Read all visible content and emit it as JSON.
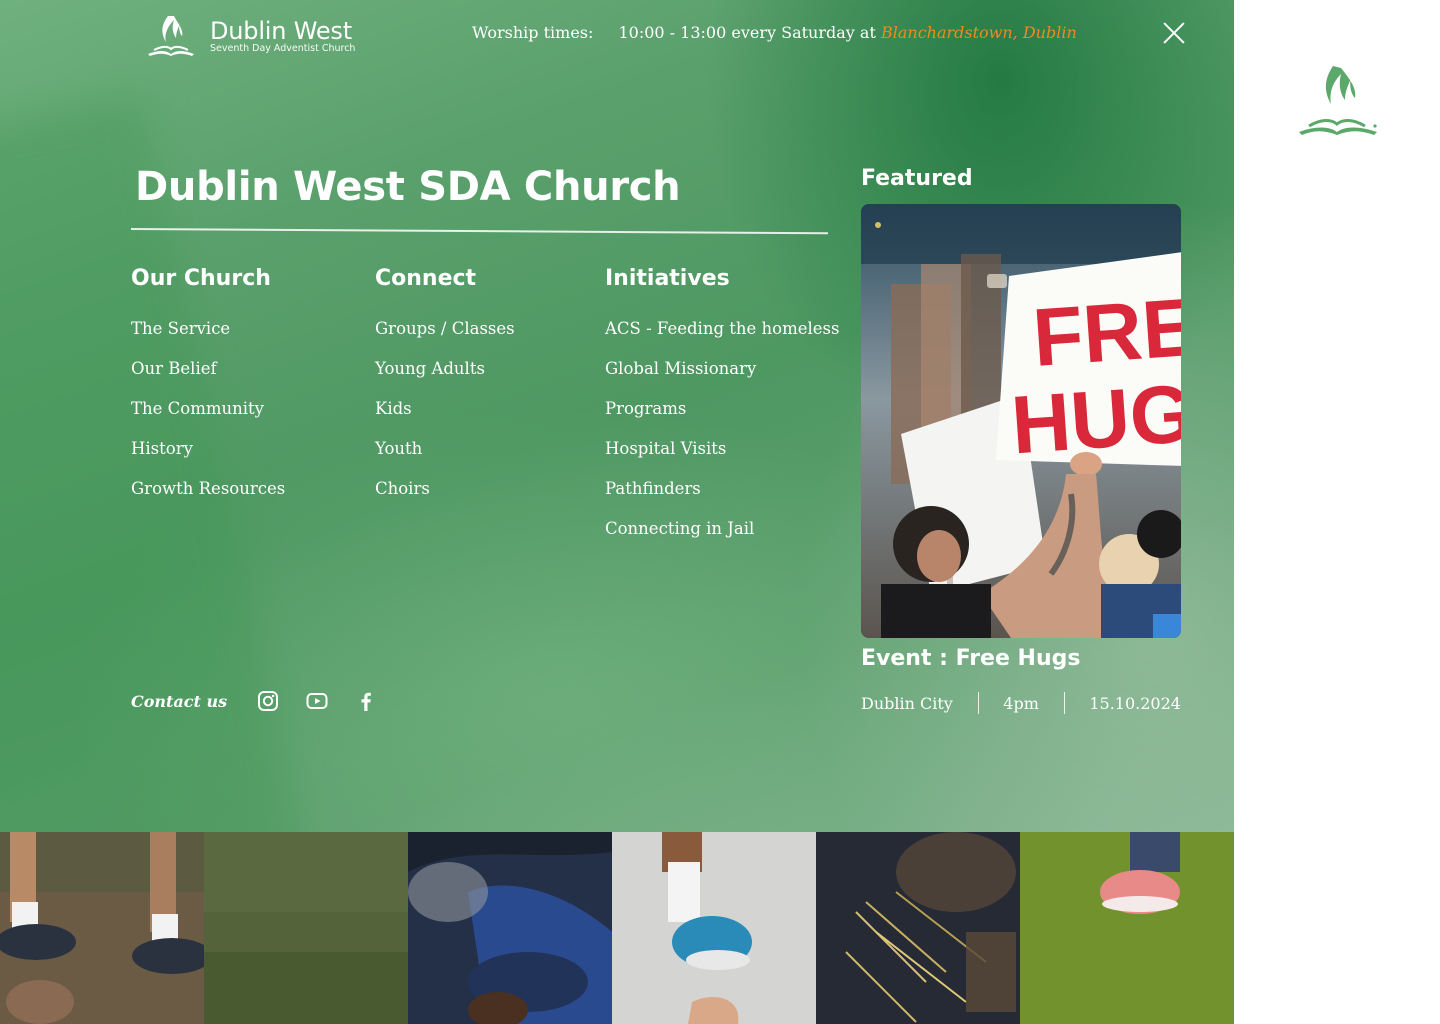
{
  "header": {
    "logo_title": "Dublin West",
    "logo_subtitle": "Seventh Day Adventist Church",
    "worship_label": "Worship times:",
    "worship_schedule": "10:00 - 13:00 every Saturday at",
    "worship_location": "Blanchardstown, Dublin"
  },
  "menu": {
    "title": "Dublin West SDA Church",
    "columns": [
      {
        "heading": "Our Church",
        "items": [
          "The Service",
          "Our Belief",
          "The Community",
          "History",
          "Growth Resources"
        ]
      },
      {
        "heading": "Connect",
        "items": [
          "Groups / Classes",
          "Young Adults",
          "Kids",
          "Youth",
          "Choirs"
        ]
      },
      {
        "heading": "Initiatives",
        "items": [
          "ACS - Feeding the homeless",
          "Global Missionary",
          "Programs",
          "Hospital Visits",
          "Pathfinders",
          "Connecting in Jail"
        ]
      }
    ],
    "contact_label": "Contact us",
    "social_icons": [
      "instagram-icon",
      "youtube-icon",
      "facebook-icon"
    ]
  },
  "featured": {
    "label": "Featured",
    "image_sign_line1": "FREE",
    "image_sign_line2": "HUGS",
    "event_title": "Event : Free Hugs",
    "location": "Dublin City",
    "time": "4pm",
    "date": "15.10.2024"
  },
  "colors": {
    "panel_green": "#4e9862",
    "accent_orange": "#f08a1e",
    "logo_green": "#5aa86a",
    "sign_red": "#d8283a"
  }
}
